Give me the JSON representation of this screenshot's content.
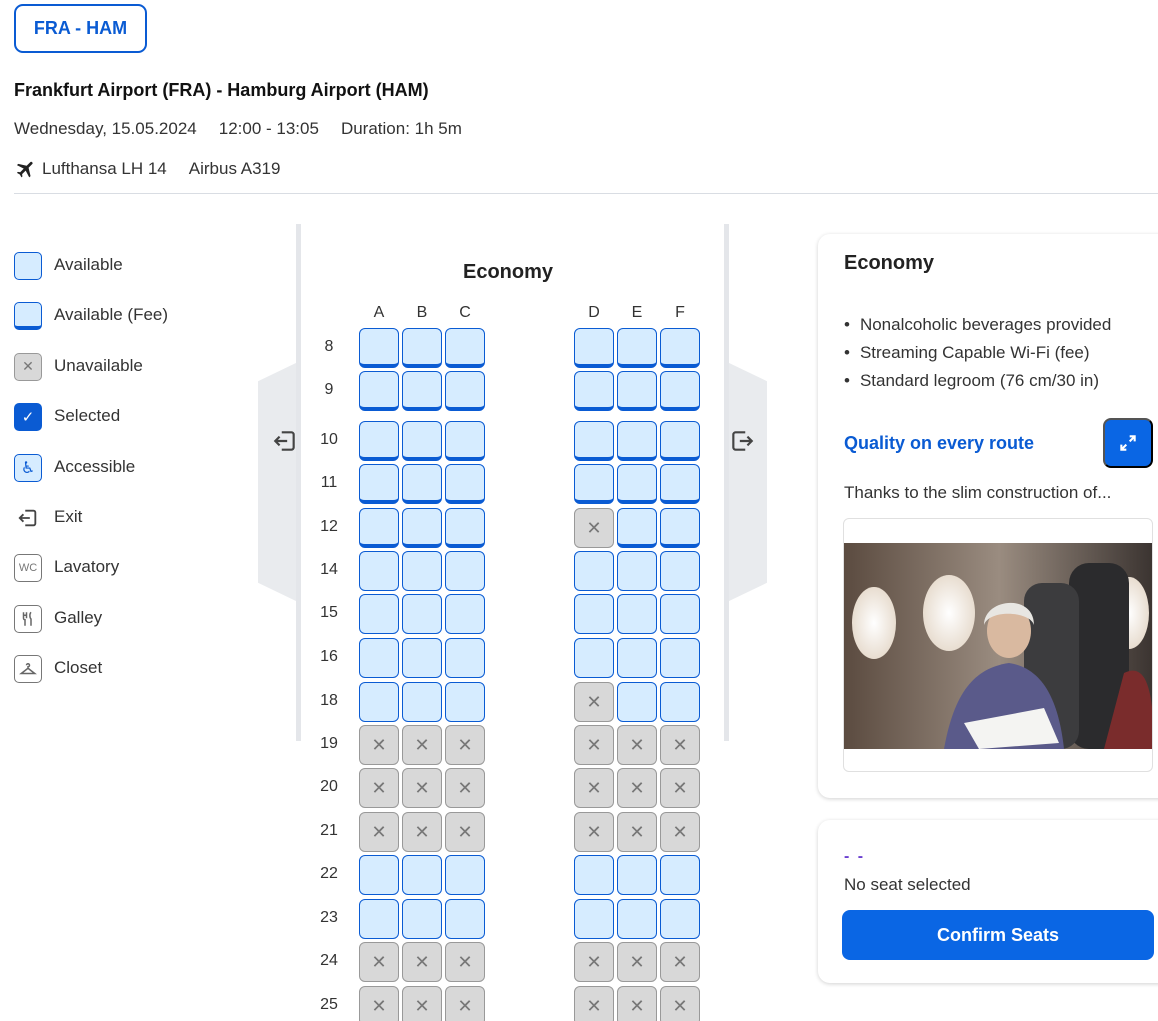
{
  "route_tab": "FRA - HAM",
  "route_title": "Frankfurt Airport (FRA) - Hamburg Airport (HAM)",
  "flight": {
    "date": "Wednesday, 15.05.2024",
    "time": "12:00 - 13:05",
    "duration": "Duration: 1h 5m",
    "carrier": "Lufthansa LH 14",
    "aircraft": "Airbus A319"
  },
  "legend": [
    {
      "label": "Available"
    },
    {
      "label": "Available (Fee)"
    },
    {
      "label": "Unavailable"
    },
    {
      "label": "Selected"
    },
    {
      "label": "Accessible"
    },
    {
      "label": "Exit"
    },
    {
      "label": "Lavatory",
      "glyph": "WC"
    },
    {
      "label": "Galley"
    },
    {
      "label": "Closet"
    }
  ],
  "cabin": {
    "title": "Economy",
    "columns": [
      "A",
      "B",
      "C",
      "D",
      "E",
      "F"
    ],
    "rows": [
      {
        "num": "8",
        "seats": [
          "fee",
          "fee",
          "fee",
          "fee",
          "fee",
          "fee"
        ]
      },
      {
        "num": "9",
        "seats": [
          "fee",
          "fee",
          "fee",
          "fee",
          "fee",
          "fee"
        ]
      },
      {
        "num": "10",
        "seats": [
          "fee",
          "fee",
          "fee",
          "fee",
          "fee",
          "fee"
        ]
      },
      {
        "num": "11",
        "seats": [
          "fee",
          "fee",
          "fee",
          "fee",
          "fee",
          "fee"
        ]
      },
      {
        "num": "12",
        "seats": [
          "fee",
          "fee",
          "fee",
          "unavailable",
          "fee",
          "fee"
        ]
      },
      {
        "num": "14",
        "seats": [
          "available",
          "available",
          "available",
          "available",
          "available",
          "available"
        ]
      },
      {
        "num": "15",
        "seats": [
          "available",
          "available",
          "available",
          "available",
          "available",
          "available"
        ]
      },
      {
        "num": "16",
        "seats": [
          "available",
          "available",
          "available",
          "available",
          "available",
          "available"
        ]
      },
      {
        "num": "18",
        "seats": [
          "available",
          "available",
          "available",
          "unavailable",
          "available",
          "available"
        ]
      },
      {
        "num": "19",
        "seats": [
          "unavailable",
          "unavailable",
          "unavailable",
          "unavailable",
          "unavailable",
          "unavailable"
        ]
      },
      {
        "num": "20",
        "seats": [
          "unavailable",
          "unavailable",
          "unavailable",
          "unavailable",
          "unavailable",
          "unavailable"
        ]
      },
      {
        "num": "21",
        "seats": [
          "unavailable",
          "unavailable",
          "unavailable",
          "unavailable",
          "unavailable",
          "unavailable"
        ]
      },
      {
        "num": "22",
        "seats": [
          "available",
          "available",
          "available",
          "available",
          "available",
          "available"
        ]
      },
      {
        "num": "23",
        "seats": [
          "available",
          "available",
          "available",
          "available",
          "available",
          "available"
        ]
      },
      {
        "num": "24",
        "seats": [
          "unavailable",
          "unavailable",
          "unavailable",
          "unavailable",
          "unavailable",
          "unavailable"
        ]
      },
      {
        "num": "25",
        "seats": [
          "unavailable",
          "unavailable",
          "unavailable",
          "unavailable",
          "unavailable",
          "unavailable"
        ]
      }
    ]
  },
  "info": {
    "title": "Economy",
    "features": [
      "Nonalcoholic beverages provided",
      "Streaming Capable Wi-Fi (fee)",
      "Standard legroom (76 cm/30 in)"
    ],
    "quality_link": "Quality on every route",
    "description": "Thanks to the slim construction of..."
  },
  "summary": {
    "dashes": "- -",
    "no_seat": "No seat selected",
    "confirm_label": "Confirm Seats"
  },
  "colors": {
    "primary": "#0a5bd3",
    "button": "#0a66e4",
    "seat_available": "#d6ecff",
    "seat_unavailable": "#d8d8d8"
  }
}
